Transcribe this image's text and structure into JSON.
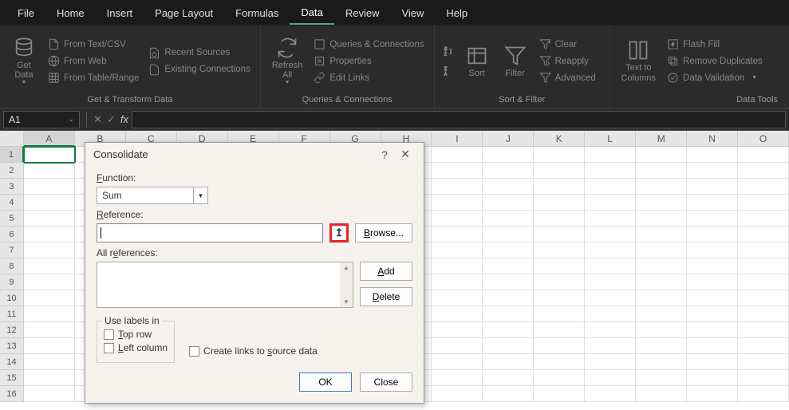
{
  "menubar": [
    "File",
    "Home",
    "Insert",
    "Page Layout",
    "Formulas",
    "Data",
    "Review",
    "View",
    "Help"
  ],
  "active_menu": "Data",
  "ribbon": {
    "groups": [
      {
        "label": "Get & Transform Data",
        "large": {
          "label": "Get\nData",
          "dd": true
        },
        "items": [
          "From Text/CSV",
          "From Web",
          "From Table/Range",
          "Recent Sources",
          "Existing Connections"
        ]
      },
      {
        "label": "Queries & Connections",
        "large": {
          "label": "Refresh\nAll",
          "dd": true
        },
        "items": [
          "Queries & Connections",
          "Properties",
          "Edit Links"
        ]
      },
      {
        "label": "Sort & Filter",
        "large_a": {
          "label": ""
        },
        "large_b": {
          "label": "Sort"
        },
        "large_c": {
          "label": "Filter"
        },
        "items": [
          "Clear",
          "Reapply",
          "Advanced"
        ]
      },
      {
        "label": "Data Tools",
        "large": {
          "label": "Text to\nColumns"
        },
        "items": [
          "Flash Fill",
          "Remove Duplicates",
          "Data Validation"
        ]
      }
    ]
  },
  "name_box": "A1",
  "columns": [
    "A",
    "B",
    "C",
    "D",
    "E",
    "F",
    "G",
    "H",
    "I",
    "J",
    "K",
    "L",
    "M",
    "N",
    "O"
  ],
  "rows": 16,
  "active_cell": {
    "row": 1,
    "col": "A"
  },
  "dialog": {
    "title": "Consolidate",
    "function_label": "Function:",
    "function_value": "Sum",
    "reference_label": "Reference:",
    "browse": "Browse...",
    "allref_label": "All references:",
    "add": "Add",
    "delete": "Delete",
    "labels_legend": "Use labels in",
    "top_row": "Top row",
    "left_col": "Left column",
    "source_links": "Create links to source data",
    "ok": "OK",
    "close": "Close"
  }
}
